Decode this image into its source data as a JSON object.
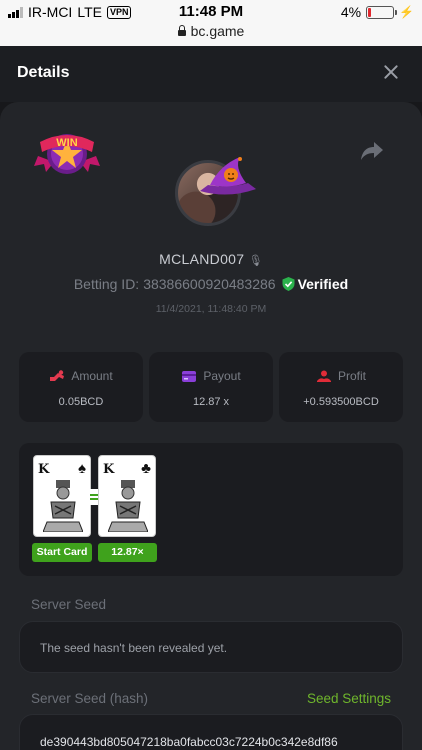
{
  "status_bar": {
    "carrier": "IR-MCI",
    "network": "LTE",
    "vpn": "VPN",
    "time": "11:48 PM",
    "battery": "4%",
    "url": "bc.game"
  },
  "header": {
    "title": "Details"
  },
  "player": {
    "username": "MCLAND007",
    "betting_label": "Betting ID:",
    "betting_id": "38386600920483286",
    "verified": "Verified",
    "datetime": "11/4/2021, 11:48:40 PM",
    "badge_text": "WIN"
  },
  "stats": [
    {
      "label": "Amount",
      "value": "0.05BCD",
      "color": "#e33a4f"
    },
    {
      "label": "Payout",
      "value": "12.87 x",
      "color": "#8a3fd8"
    },
    {
      "label": "Profit",
      "value": "+0.593500BCD",
      "color": "#e02c38"
    }
  ],
  "game": {
    "cards": [
      {
        "rank": "K",
        "suit": "♠"
      },
      {
        "rank": "K",
        "suit": "♣"
      }
    ],
    "start_label": "Start Card",
    "multiplier_label": "12.87×"
  },
  "seeds": {
    "server_seed_label": "Server Seed",
    "server_seed_value": "The seed hasn't been revealed yet.",
    "server_seed_hash_label": "Server Seed (hash)",
    "seed_settings_label": "Seed Settings",
    "server_seed_hash_value": "de390443bd805047218ba0fabcc03c7224b0c342e8df86"
  },
  "colors": {
    "accent_green": "#3fa21c",
    "link_green": "#6fb62c",
    "verified_green": "#2bb24c"
  }
}
